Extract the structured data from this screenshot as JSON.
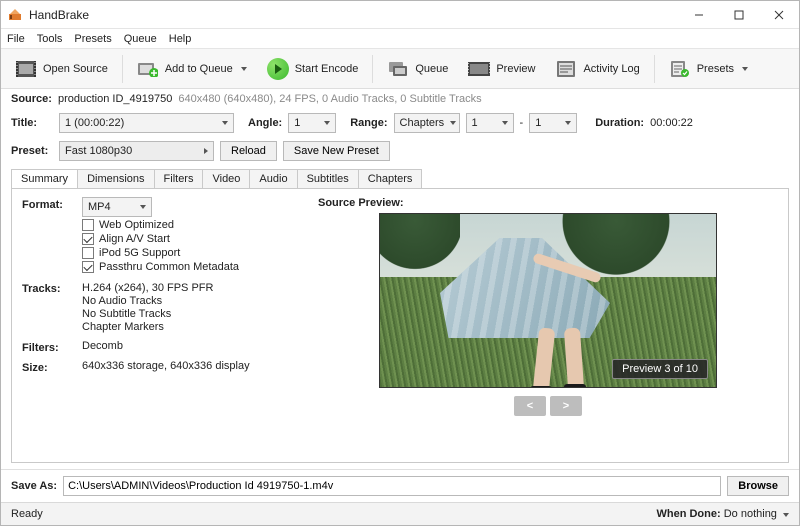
{
  "app": {
    "title": "HandBrake"
  },
  "menu": {
    "file": "File",
    "tools": "Tools",
    "presets": "Presets",
    "queue": "Queue",
    "help": "Help"
  },
  "toolbar": {
    "open_source": "Open Source",
    "add_to_queue": "Add to Queue",
    "start_encode": "Start Encode",
    "queue": "Queue",
    "preview": "Preview",
    "activity_log": "Activity Log",
    "presets": "Presets"
  },
  "source": {
    "label": "Source:",
    "name": "production ID_4919750",
    "meta": "640x480 (640x480), 24 FPS, 0 Audio Tracks, 0 Subtitle Tracks"
  },
  "title_row": {
    "title_label": "Title:",
    "title_value": "1  (00:00:22)",
    "angle_label": "Angle:",
    "angle_value": "1",
    "range_label": "Range:",
    "range_type": "Chapters",
    "range_from": "1",
    "range_sep": "-",
    "range_to": "1",
    "duration_label": "Duration:",
    "duration_value": "00:00:22"
  },
  "preset_row": {
    "label": "Preset:",
    "value": "Fast 1080p30",
    "reload": "Reload",
    "save_new": "Save New Preset"
  },
  "tabs": {
    "summary": "Summary",
    "dimensions": "Dimensions",
    "filters": "Filters",
    "video": "Video",
    "audio": "Audio",
    "subtitles": "Subtitles",
    "chapters": "Chapters"
  },
  "summary": {
    "format_label": "Format:",
    "format_value": "MP4",
    "check_web": "Web Optimized",
    "check_align": "Align A/V Start",
    "check_ipod": "iPod 5G Support",
    "check_meta": "Passthru Common Metadata",
    "tracks_label": "Tracks:",
    "tracks_1": "H.264 (x264), 30 FPS PFR",
    "tracks_2": "No Audio Tracks",
    "tracks_3": "No Subtitle Tracks",
    "tracks_4": "Chapter Markers",
    "filters_label": "Filters:",
    "filters_value": "Decomb",
    "size_label": "Size:",
    "size_value": "640x336 storage, 640x336 display"
  },
  "preview": {
    "title": "Source Preview:",
    "tag": "Preview 3 of 10",
    "prev": "<",
    "next": ">"
  },
  "save": {
    "label": "Save As:",
    "path": "C:\\Users\\ADMIN\\Videos\\Production Id 4919750-1.m4v",
    "browse": "Browse"
  },
  "status": {
    "ready": "Ready",
    "when_done_label": "When Done:",
    "when_done_value": "Do nothing"
  }
}
